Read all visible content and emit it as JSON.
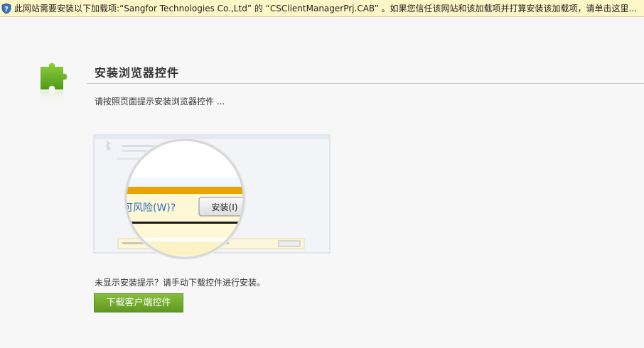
{
  "infobar": {
    "message": "此网站需要安装以下加载项:“Sangfor Technologies Co.,Ltd” 的 “CSClientManagerPrj.CAB” 。如果您信任该网站和该加载项并打算安装该加载项，请单击这里..."
  },
  "header": {
    "title": "安装浏览器控件"
  },
  "main": {
    "instruction": "请按照页面提示安装浏览器控件 ...",
    "illustration": {
      "prompt_text": "可风险(W)?",
      "install_button": "安装(I)"
    },
    "no_prompt_text": "未显示安装提示？请手动下载控件进行安装。",
    "download_button": "下载客户端控件"
  },
  "colors": {
    "accent_green": "#6aa82a",
    "infobar_bg": "#fdf7c8",
    "illustration_stripe": "#e8a400"
  },
  "icons": {
    "infobar": "shield-question-icon",
    "header": "puzzle-piece-icon"
  }
}
